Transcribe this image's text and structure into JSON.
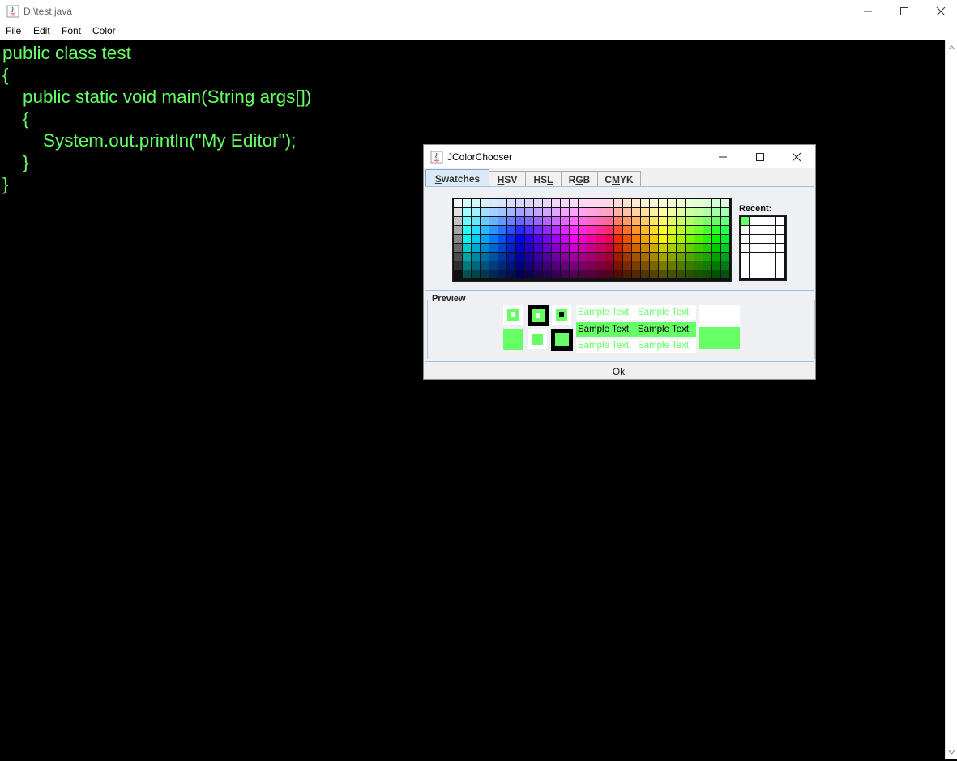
{
  "window": {
    "title": "D:\\test.java"
  },
  "menu": [
    "File",
    "Edit",
    "Font",
    "Color"
  ],
  "editor": {
    "text_color": "#66ff66",
    "background": "#000000",
    "lines": [
      "public class test",
      "{",
      "    public static void main(String args[])",
      "    {",
      "        System.out.println(\"My Editor\");",
      "    }",
      "}"
    ]
  },
  "dialog": {
    "title": "JColorChooser",
    "tabs": [
      {
        "pre": "",
        "mn": "S",
        "post": "watches",
        "selected": true
      },
      {
        "pre": "",
        "mn": "H",
        "post": "SV",
        "selected": false
      },
      {
        "pre": "HS",
        "mn": "L",
        "post": "",
        "selected": false
      },
      {
        "pre": "R",
        "mn": "G",
        "post": "B",
        "selected": false
      },
      {
        "pre": "C",
        "mn": "M",
        "post": "YK",
        "selected": false
      }
    ],
    "recent_label": "Recent:",
    "recent_colors": [
      "#66ff66"
    ],
    "preview_label": "Preview",
    "sample_text": "Sample Text",
    "selected_color": "#66ff66",
    "ok_label": "Ok"
  }
}
